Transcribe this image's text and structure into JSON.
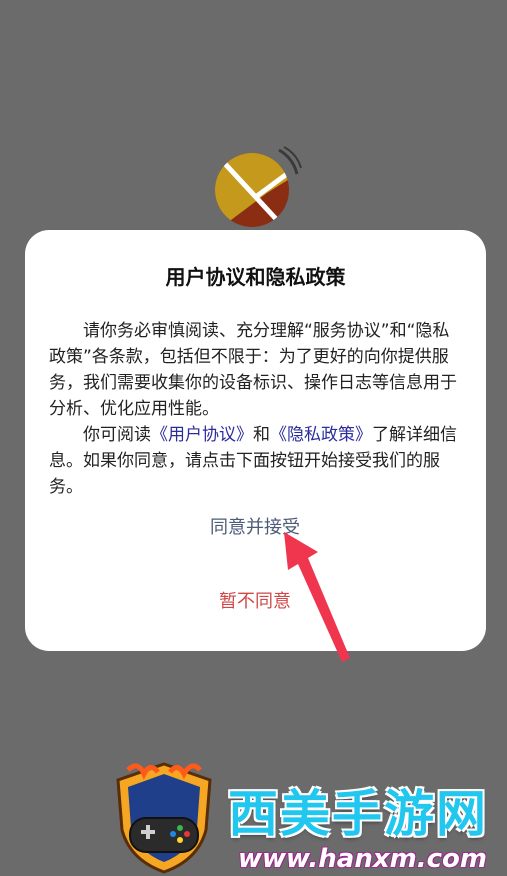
{
  "dialog": {
    "title": "用户协议和隐私政策",
    "paragraph1": "请你务必审慎阅读、充分理解“服务协议”和“隐私政策”各条款，包括但不限于：为了更好的向你提供服务，我们需要收集你的设备标识、操作日志等信息用于分析、优化应用性能。",
    "paragraph2_prefix": "你可阅读",
    "user_agreement_link": "《用户协议》",
    "paragraph2_and": "和",
    "privacy_policy_link": "《隐私政策》",
    "paragraph2_suffix": "了解详细信息。如果你同意，请点击下面按钮开始接受我们的服务。",
    "agree_label": "同意并接受",
    "decline_label": "暂不同意"
  },
  "watermark": {
    "brand": "西美手游网",
    "url": "www.hanxm.com"
  },
  "colors": {
    "background": "#6b6b6b",
    "link": "#2c2c9c",
    "agree": "#4b5b78",
    "decline": "#d24848",
    "arrow": "#f0354e",
    "watermark_text": "#21c7ee"
  },
  "icons": {
    "app_logo": "app-logo-icon",
    "arrow": "red-arrow-annotation",
    "watermark_logo": "gamepad-shield-icon"
  }
}
